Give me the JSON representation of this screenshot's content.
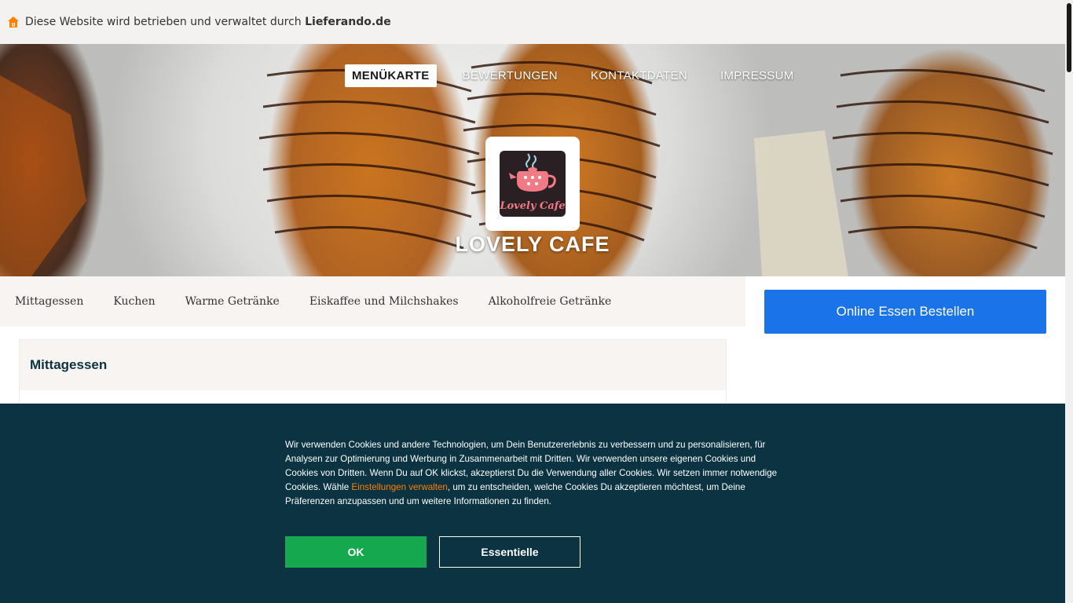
{
  "notice": {
    "prefix": "Diese Website wird betrieben und verwaltet durch ",
    "brand": "Lieferando.de",
    "icon": "house-icon"
  },
  "hero": {
    "nav": [
      {
        "label": "MENÜKARTE",
        "active": true
      },
      {
        "label": "BEWERTUNGEN",
        "active": false
      },
      {
        "label": "KONTAKTDATEN",
        "active": false
      },
      {
        "label": "IMPRESSUM",
        "active": false
      }
    ],
    "logo_word": "Lovely Cafe",
    "name": "LOVELY CAFE"
  },
  "categories": [
    "Mittagessen",
    "Kuchen",
    "Warme Getränke",
    "Eiskaffee und Milchshakes",
    "Alkoholfreie Getränke"
  ],
  "order_button": "Online Essen Bestellen",
  "section": {
    "title": "Mittagessen"
  },
  "cookie": {
    "text_before": "Wir verwenden Cookies und andere Technologien, um Dein Benutzererlebnis zu verbessern und zu personalisieren, für Analysen zur Optimierung und Werbung in Zusammenarbeit mit Dritten. Wir verwenden unsere eigenen Cookies und Cookies von Dritten. Wenn Du auf OK klickst, akzeptierst Du die Verwendung aller Cookies. Wir setzen immer notwendige Cookies. Wähle ",
    "link": "Einstellungen verwalten",
    "text_after": ", um zu entscheiden, welche Cookies Du akzeptieren möchtest, um Deine Präferenzen anzupassen und um weitere Informationen zu finden.",
    "ok": "OK",
    "essential": "Essentielle"
  },
  "colors": {
    "accent": "#ff8000",
    "order_blue": "#1a73e8",
    "ok_green": "#16a84e",
    "banner": "#0b3341"
  }
}
